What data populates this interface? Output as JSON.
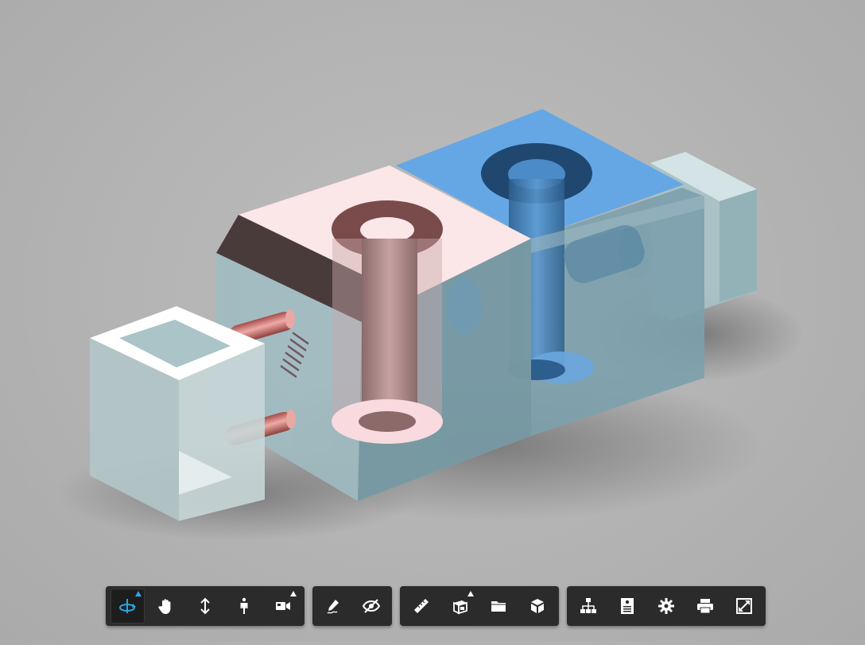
{
  "viewer": {
    "accent_color": "#2aa7e0",
    "part_colors": {
      "pink_block_top": "#fbe6e8",
      "blue_block_top": "#65a7e4",
      "copper_pins": "#c56b68",
      "translucent_body": "#a9c6cc"
    }
  },
  "toolbar": {
    "groups": [
      {
        "tools": [
          {
            "icon": "orbit-icon",
            "active": true,
            "has_menu": true
          },
          {
            "icon": "pan-hand-icon",
            "active": false,
            "has_menu": false
          },
          {
            "icon": "zoom-arrows-icon",
            "active": false,
            "has_menu": false
          },
          {
            "icon": "first-person-icon",
            "active": false,
            "has_menu": false
          },
          {
            "icon": "camera-icon",
            "active": false,
            "has_menu": true
          }
        ]
      },
      {
        "tools": [
          {
            "icon": "markup-pencil-icon",
            "active": false,
            "has_menu": false
          },
          {
            "icon": "hide-eye-icon",
            "active": false,
            "has_menu": false
          }
        ]
      },
      {
        "tools": [
          {
            "icon": "measure-ruler-icon",
            "active": false,
            "has_menu": false
          },
          {
            "icon": "section-box-icon",
            "active": false,
            "has_menu": true
          },
          {
            "icon": "explode-folder-icon",
            "active": false,
            "has_menu": false
          },
          {
            "icon": "model-cube-icon",
            "active": false,
            "has_menu": false
          }
        ]
      },
      {
        "tools": [
          {
            "icon": "model-browser-icon",
            "active": false,
            "has_menu": false
          },
          {
            "icon": "properties-icon",
            "active": false,
            "has_menu": false
          },
          {
            "icon": "settings-gear-icon",
            "active": false,
            "has_menu": false
          },
          {
            "icon": "print-icon",
            "active": false,
            "has_menu": false
          },
          {
            "icon": "fullscreen-icon",
            "active": false,
            "has_menu": false
          }
        ]
      }
    ]
  }
}
